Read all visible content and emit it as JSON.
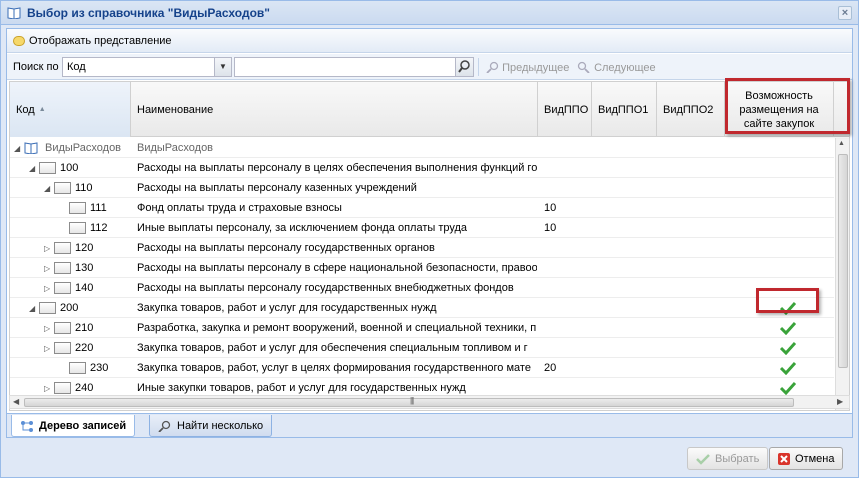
{
  "window": {
    "title": "Выбор из справочника \"ВидыРасходов\""
  },
  "toolbar": {
    "view_button": "Отображать представление"
  },
  "search": {
    "label": "Поиск по",
    "field_value": "Код",
    "query": "",
    "prev": "Предыдущее",
    "next": "Следующее"
  },
  "columns": {
    "code": "Код",
    "name": "Наименование",
    "vidppo": "ВидППО",
    "vidppo1": "ВидППО1",
    "vidppo2": "ВидППО2",
    "posting": "Возможность размещения на сайте закупок"
  },
  "rows": [
    {
      "code": "ВидыРасходов",
      "name": "ВидыРасходов",
      "vidppo": "",
      "check": false
    },
    {
      "code": "100",
      "name": "Расходы на выплаты персоналу в целях обеспечения выполнения функций го",
      "vidppo": "",
      "check": false
    },
    {
      "code": "110",
      "name": "Расходы на выплаты персоналу казенных учреждений",
      "vidppo": "",
      "check": false
    },
    {
      "code": "111",
      "name": "Фонд оплаты труда и страховые взносы",
      "vidppo": "10",
      "check": false
    },
    {
      "code": "112",
      "name": "Иные выплаты персоналу, за исключением фонда оплаты труда",
      "vidppo": "10",
      "check": false
    },
    {
      "code": "120",
      "name": "Расходы на выплаты персоналу государственных органов",
      "vidppo": "",
      "check": false
    },
    {
      "code": "130",
      "name": "Расходы на выплаты персоналу в сфере национальной безопасности, правоо",
      "vidppo": "",
      "check": false
    },
    {
      "code": "140",
      "name": "Расходы на выплаты персоналу государственных внебюджетных фондов",
      "vidppo": "",
      "check": false
    },
    {
      "code": "200",
      "name": "Закупка товаров, работ и услуг для государственных нужд",
      "vidppo": "",
      "check": true
    },
    {
      "code": "210",
      "name": "Разработка, закупка и ремонт вооружений, военной и специальной техники, п",
      "vidppo": "",
      "check": true
    },
    {
      "code": "220",
      "name": "Закупка товаров, работ и услуг для обеспечения специальным топливом и г",
      "vidppo": "",
      "check": true
    },
    {
      "code": "230",
      "name": "Закупка товаров, работ, услуг в целях формирования государственного мате",
      "vidppo": "20",
      "check": true
    },
    {
      "code": "240",
      "name": "Иные закупки товаров, работ и услуг для государственных нужд",
      "vidppo": "",
      "check": true
    }
  ],
  "tabs": {
    "tree": "Дерево записей",
    "find": "Найти несколько"
  },
  "footer": {
    "select": "Выбрать",
    "cancel": "Отмена"
  },
  "colors": {
    "accent": "#15428b",
    "highlight_box": "#c0282e",
    "check": "#3aa33a"
  }
}
